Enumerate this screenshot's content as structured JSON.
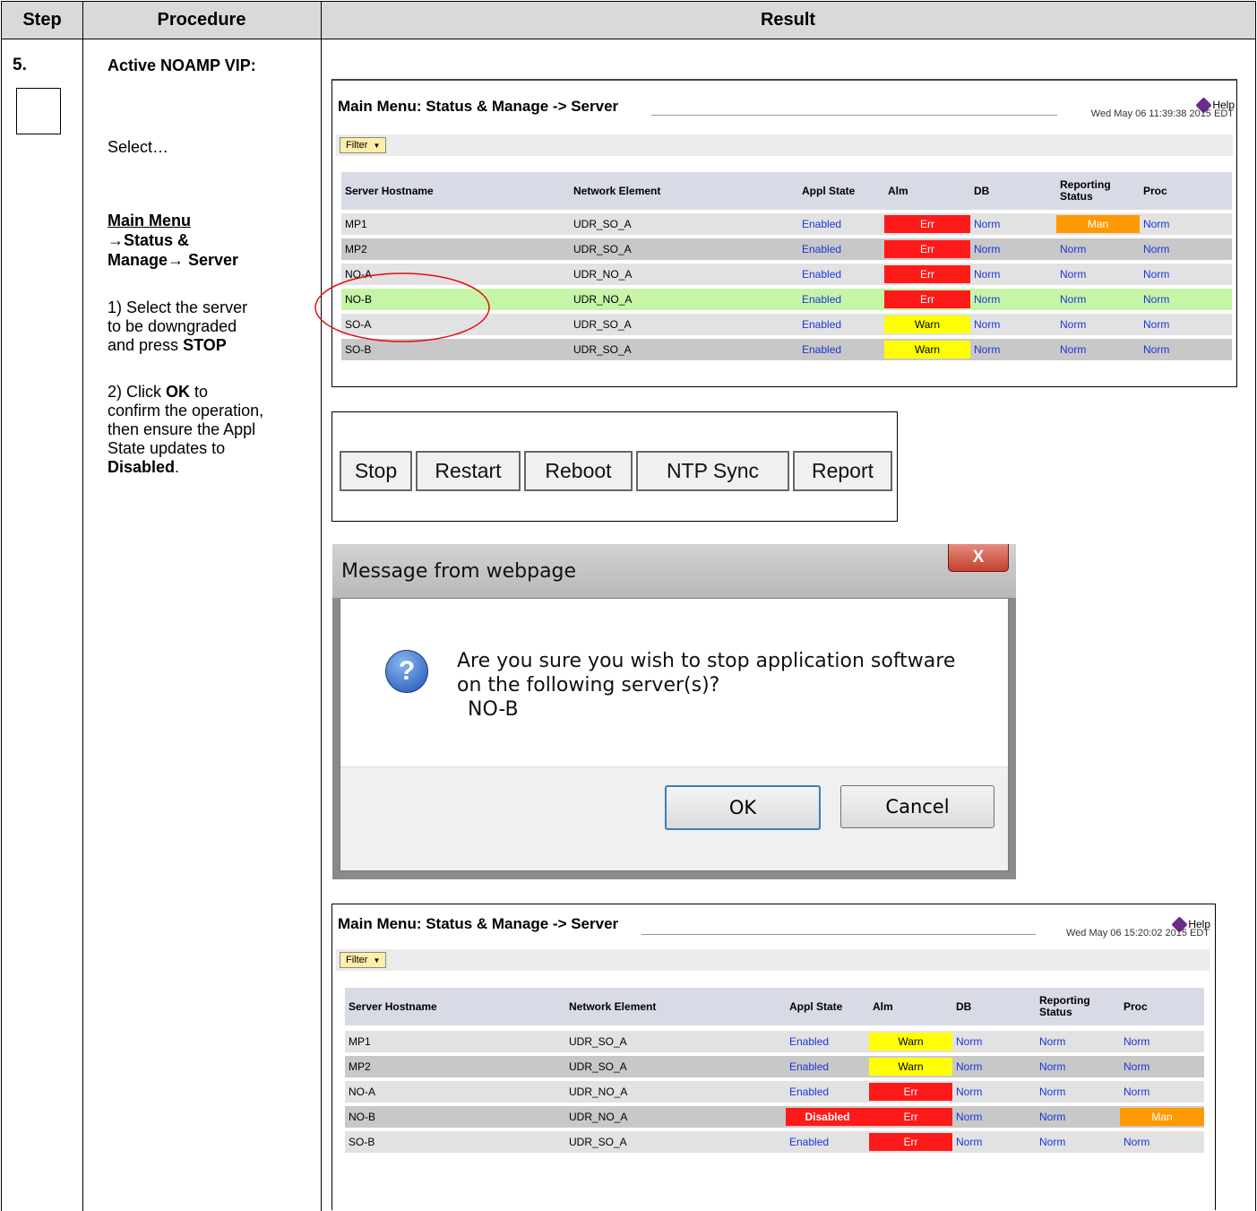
{
  "header": {
    "step": "Step",
    "procedure": "Procedure",
    "result": "Result"
  },
  "step": {
    "number": "5.",
    "title": "Active NOAMP VIP:",
    "select": "Select…",
    "menu_path_1": "Main Menu",
    "menu_path_2": "→Status &",
    "menu_path_3": "Manage→ Server",
    "instr1_pre": "1) Select the server",
    "instr1_mid": "to be downgraded",
    "instr1_tail_a": "and press ",
    "instr1_bold": "STOP",
    "instr2_a": "2) Click ",
    "instr2_bold": "OK",
    "instr2_b": " to",
    "instr2_c": "confirm the operation,",
    "instr2_d": "then ensure the Appl",
    "instr2_e": "State updates to",
    "instr2_final_bold": "Disabled",
    "instr2_period": "."
  },
  "panel1": {
    "title": "Main Menu: Status & Manage -> Server",
    "help": "Help",
    "date": "Wed May 06 11:39:38 2015 EDT",
    "filter": "Filter",
    "columns": [
      "Server Hostname",
      "Network Element",
      "Appl State",
      "Alm",
      "DB",
      "Reporting Status",
      "Proc"
    ],
    "rows": [
      {
        "host": "MP1",
        "ne": "UDR_SO_A",
        "appl": "Enabled",
        "alm": "Err",
        "db": "Norm",
        "rep": "Man",
        "proc": "Norm"
      },
      {
        "host": "MP2",
        "ne": "UDR_SO_A",
        "appl": "Enabled",
        "alm": "Err",
        "db": "Norm",
        "rep": "Norm",
        "proc": "Norm"
      },
      {
        "host": "NO-A",
        "ne": "UDR_NO_A",
        "appl": "Enabled",
        "alm": "Err",
        "db": "Norm",
        "rep": "Norm",
        "proc": "Norm"
      },
      {
        "host": "NO-B",
        "ne": "UDR_NO_A",
        "appl": "Enabled",
        "alm": "Err",
        "db": "Norm",
        "rep": "Norm",
        "proc": "Norm"
      },
      {
        "host": "SO-A",
        "ne": "UDR_SO_A",
        "appl": "Enabled",
        "alm": "Warn",
        "db": "Norm",
        "rep": "Norm",
        "proc": "Norm"
      },
      {
        "host": "SO-B",
        "ne": "UDR_SO_A",
        "appl": "Enabled",
        "alm": "Warn",
        "db": "Norm",
        "rep": "Norm",
        "proc": "Norm"
      }
    ]
  },
  "buttons": [
    "Stop",
    "Restart",
    "Reboot",
    "NTP Sync",
    "Report"
  ],
  "dialog": {
    "title": "Message from webpage",
    "close": "X",
    "line1": "Are you sure you wish to stop application software",
    "line2": "on the following server(s)?",
    "line3": "NO-B",
    "ok": "OK",
    "cancel": "Cancel"
  },
  "panel2": {
    "title": "Main Menu: Status & Manage -> Server",
    "help": "Help",
    "date": "Wed May 06 15:20:02 2015 EDT",
    "filter": "Filter",
    "columns": [
      "Server Hostname",
      "Network Element",
      "Appl State",
      "Alm",
      "DB",
      "Reporting Status",
      "Proc"
    ],
    "rows": [
      {
        "host": "MP1",
        "ne": "UDR_SO_A",
        "appl": "Enabled",
        "alm": "Warn",
        "db": "Norm",
        "rep": "Norm",
        "proc": "Norm"
      },
      {
        "host": "MP2",
        "ne": "UDR_SO_A",
        "appl": "Enabled",
        "alm": "Warn",
        "db": "Norm",
        "rep": "Norm",
        "proc": "Norm"
      },
      {
        "host": "NO-A",
        "ne": "UDR_NO_A",
        "appl": "Enabled",
        "alm": "Err",
        "db": "Norm",
        "rep": "Norm",
        "proc": "Norm"
      },
      {
        "host": "NO-B",
        "ne": "UDR_NO_A",
        "appl": "Disabled",
        "alm": "Err",
        "db": "Norm",
        "rep": "Norm",
        "proc": "Man"
      },
      {
        "host": "SO-B",
        "ne": "UDR_SO_A",
        "appl": "Enabled",
        "alm": "Err",
        "db": "Norm",
        "rep": "Norm",
        "proc": "Norm"
      }
    ]
  },
  "colors": {
    "err": "#ff1a1a",
    "warn": "#ffff00",
    "man": "#ff9900",
    "link": "#1a35d8",
    "selected": "#c6f5a8",
    "row_a": "#e2e2e2",
    "row_b": "#c8c8c8",
    "highlight_circle": "#e01010"
  }
}
